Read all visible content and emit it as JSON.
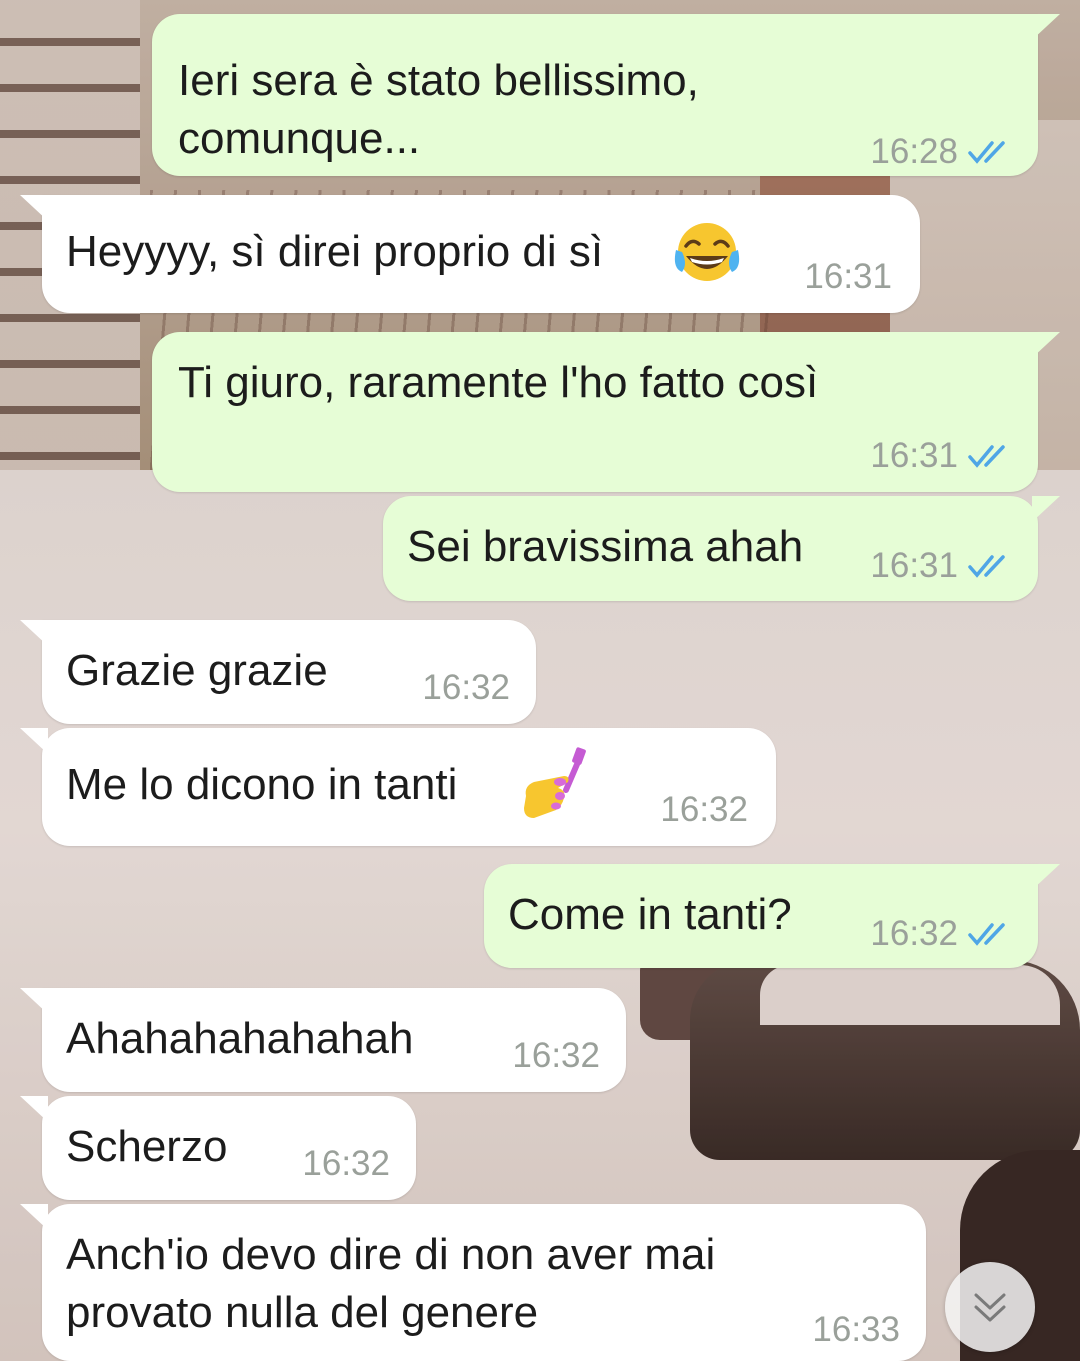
{
  "messages": [
    {
      "direction": "out",
      "text": "Ieri sera è stato bellissimo,\ncomunque...",
      "time": "16:28",
      "status": "read"
    },
    {
      "direction": "in",
      "text": "Heyyyy, sì direi proprio di sì",
      "emoji": "face-with-tears-of-joy",
      "time": "16:31"
    },
    {
      "direction": "out",
      "text": "Ti giuro, raramente l'ho fatto così",
      "time": "16:31",
      "status": "read"
    },
    {
      "direction": "out",
      "text": "Sei bravissima ahah",
      "time": "16:31",
      "status": "read"
    },
    {
      "direction": "in",
      "text": "Grazie grazie",
      "time": "16:32"
    },
    {
      "direction": "in",
      "text": "Me lo dicono in tanti",
      "emoji": "nail-polish",
      "time": "16:32"
    },
    {
      "direction": "out",
      "text": "Come in tanti?",
      "time": "16:32",
      "status": "read"
    },
    {
      "direction": "in",
      "text": "Ahahahahahahah",
      "time": "16:32"
    },
    {
      "direction": "in",
      "text": "Scherzo",
      "time": "16:32"
    },
    {
      "direction": "in",
      "text": "Anch'io devo dire di non aver mai\nprovato nulla del genere",
      "time": "16:33"
    }
  ],
  "icons": {
    "read_receipt": "double-check-icon",
    "scroll_down": "double-chevron-down-icon"
  },
  "colors": {
    "outgoing_bubble": "#e6fdd6",
    "incoming_bubble": "#ffffff",
    "read_ticks": "#4fa6e6",
    "timestamp": "#9aa09a"
  }
}
